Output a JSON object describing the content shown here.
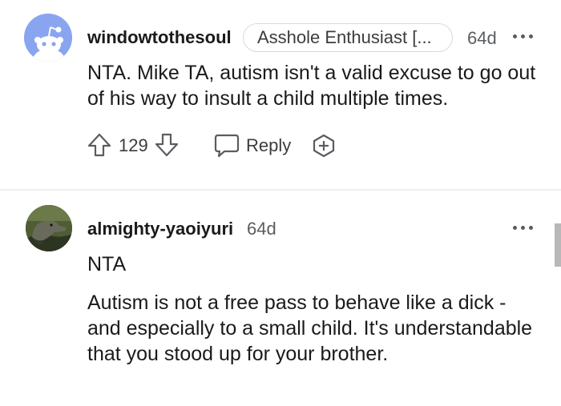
{
  "comments": [
    {
      "username": "windowtothesoul",
      "flair": "Asshole Enthusiast [...",
      "age": "64d",
      "body": "NTA. Mike TA, autism isn't a valid excuse to go out of his way to insult a child multiple times.",
      "score": "129",
      "reply_label": "Reply",
      "icons": {
        "avatar": "reddit-snoo-avatar",
        "upvote": "arrow-up-icon",
        "downvote": "arrow-down-icon",
        "reply": "speech-bubble-icon",
        "award": "award-plus-icon",
        "more": "more-dots-icon"
      }
    },
    {
      "username": "almighty-yaoiyuri",
      "age": "64d",
      "body_paragraphs": [
        "NTA",
        "Autism is not a free pass to behave like a dick - and especially to a small child. It's understandable that you stood up for your brother."
      ],
      "icons": {
        "avatar": "dinosaur-avatar",
        "more": "more-dots-icon"
      }
    }
  ],
  "colors": {
    "avatar_bg": "#8aa5f0",
    "text": "#1a1a1b",
    "meta": "#5a5d60",
    "divider": "#edeff1"
  }
}
